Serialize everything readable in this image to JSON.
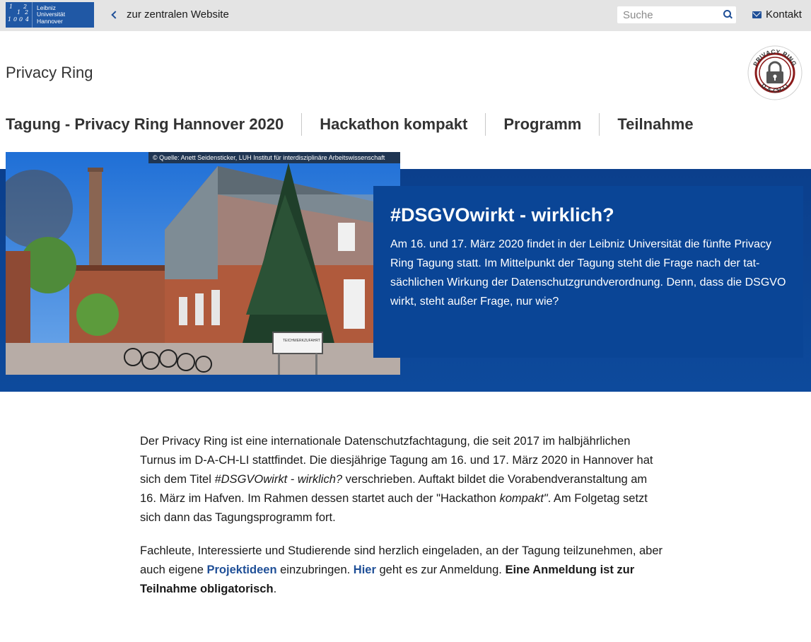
{
  "topbar": {
    "logo_lines": [
      "Leibniz",
      "Universität",
      "Hannover"
    ],
    "logo_digits": [
      "1",
      "2",
      "1",
      "2",
      "1",
      "0",
      "0",
      "4"
    ],
    "back_link": "zur zentralen Website",
    "search_placeholder": "Suche",
    "contact_label": "Kontakt"
  },
  "site": {
    "title": "Privacy Ring",
    "badge_top_text": "PRIVACY RING",
    "badge_bottom_text": "D-A-CH-LI"
  },
  "nav": {
    "items": [
      "Tagung - Privacy Ring Hannover 2020",
      "Hackathon kompakt",
      "Programm",
      "Teilnahme"
    ]
  },
  "hero": {
    "credit": "© Quelle: Anett Seidensticker, LUH Institut für interdisziplinäre Arbeitswissenschaft",
    "sign_text": "TEICHWERKZUFAHRT",
    "title": "#DSGVOwirkt - wirklich?",
    "text": "Am 16. und 17. März 2020 findet in der Leibniz Universität die fünfte Privacy Ring Tagung statt. Im Mittelpunkt der Tagung steht die Frage nach der tat-sächlichen Wirkung der Datenschutzgrundverordnung. Denn, dass die DSGVO wirkt, steht außer Frage, nur wie?"
  },
  "content": {
    "p1_part1": "Der Privacy Ring ist eine internationale Datenschutzfachtagung, die seit 2017 im halbjährlichen Turnus im D-A-CH-LI stattfindet. Die diesjährige Tagung am 16. und 17. März 2020 in Hannover hat sich dem Titel ",
    "p1_em": "#DSGVOwirkt - wirklich?",
    "p1_part2": " verschrieben. Auftakt bildet die Vorabendveranstaltung am 16. März im Hafven. Im Rahmen dessen startet auch der \"Hackathon ",
    "p1_em2": "kompakt\"",
    "p1_part3": ". Am Folgetag setzt sich dann das Tagungsprogramm fort.",
    "p2_part1": "Fachleute, Interessierte und Studierende sind herzlich eingeladen, an der Tagung teilzunehmen, aber auch eigene ",
    "p2_link1": "Projektideen",
    "p2_part2": " einzubringen. ",
    "p2_link2": "Hier",
    "p2_part3": " geht es zur Anmeldung. ",
    "p2_bold": "Eine Anmeldung ist zur Teilnahme obligatorisch",
    "p2_end": "."
  },
  "colors": {
    "brand_blue": "#2058a5",
    "hero_blue": "#0a4596",
    "link_blue": "#1f4f97",
    "badge_red": "#8b1a1a"
  }
}
